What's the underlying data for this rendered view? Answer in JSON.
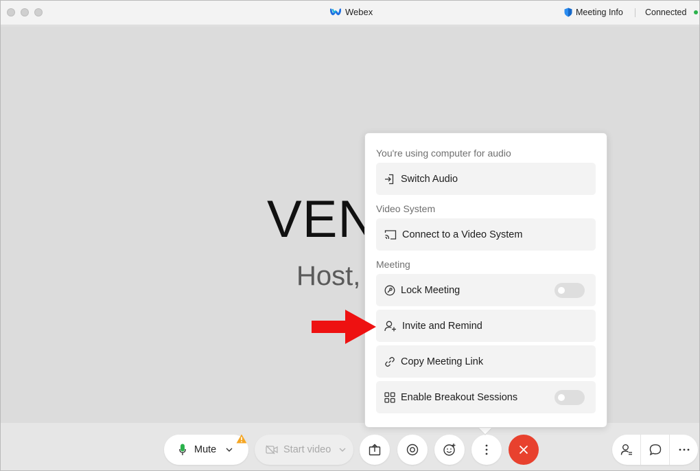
{
  "window": {
    "title": "Webex",
    "meeting_info": "Meeting Info",
    "status": "Connected"
  },
  "stage": {
    "name_partial": "VEN",
    "subtitle_partial": "Host,"
  },
  "controls": {
    "mute_label": "Mute",
    "start_video_label": "Start video",
    "icons": [
      "microphone-icon",
      "warning-icon",
      "chevron-down-icon",
      "video-camera-icon",
      "share-icon",
      "record-icon",
      "reactions-icon",
      "more-icon",
      "end-call-icon",
      "participants-icon",
      "chat-icon",
      "more-horizontal-icon"
    ]
  },
  "menu": {
    "audio_section": "You're using computer for audio",
    "switch_audio": "Switch Audio",
    "video_section": "Video System",
    "connect_video": "Connect to a Video System",
    "meeting_section": "Meeting",
    "lock_meeting": "Lock Meeting",
    "lock_meeting_on": false,
    "invite_remind": "Invite and Remind",
    "copy_link": "Copy Meeting Link",
    "breakout": "Enable Breakout Sessions",
    "breakout_on": false
  },
  "colors": {
    "end_call": "#e8412e",
    "annotation_arrow": "#ee1111",
    "connected_dot": "#2bb24c"
  }
}
